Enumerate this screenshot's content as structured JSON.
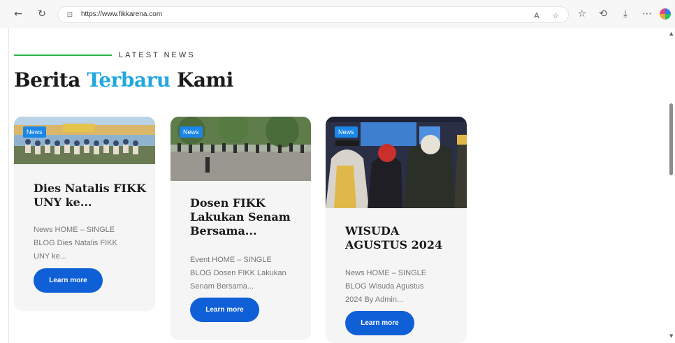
{
  "browser": {
    "url": "https://www.fikkarena.com"
  },
  "section": {
    "kicker": "LATEST NEWS",
    "heading_part1": "Berita ",
    "heading_accent": "Terbaru",
    "heading_part2": " Kami"
  },
  "colors": {
    "accent": "#22a7e0",
    "kicker_line": "#29b34a",
    "button": "#0f5fd6",
    "badge": "#1a86e8"
  },
  "cards": [
    {
      "badge": "News",
      "title_line1": "Dies Natalis FIKK",
      "title_line2": "UNY ke...",
      "excerpt_line1": "News HOME – SINGLE",
      "excerpt_line2": "BLOG Dies Natalis FIKK",
      "excerpt_line3": "UNY ke...",
      "button": "Learn more"
    },
    {
      "badge": "News",
      "title_line1": "Dosen FIKK",
      "title_line2": "Lakukan Senam",
      "title_line3": "Bersama...",
      "excerpt_line1": "Event HOME – SINGLE",
      "excerpt_line2": "BLOG Dosen FIKK Lakukan",
      "excerpt_line3": "Senam Bersama...",
      "button": "Learn more"
    },
    {
      "badge": "News",
      "title_line1": "WISUDA",
      "title_line2": "AGUSTUS 2024",
      "excerpt_line1": "News HOME – SINGLE",
      "excerpt_line2": "BLOG Wisuda Agustus",
      "excerpt_line3": "2024 By Admin...",
      "button": "Learn more"
    }
  ],
  "icons": {
    "back": "back-arrow-icon",
    "refresh": "refresh-icon",
    "lock": "lock-icon",
    "read_aloud": "read-aloud-icon",
    "favorite": "star-icon",
    "favorites": "favorites-icon",
    "history": "history-icon",
    "download": "download-icon",
    "more": "more-icon",
    "copilot": "copilot-icon"
  }
}
